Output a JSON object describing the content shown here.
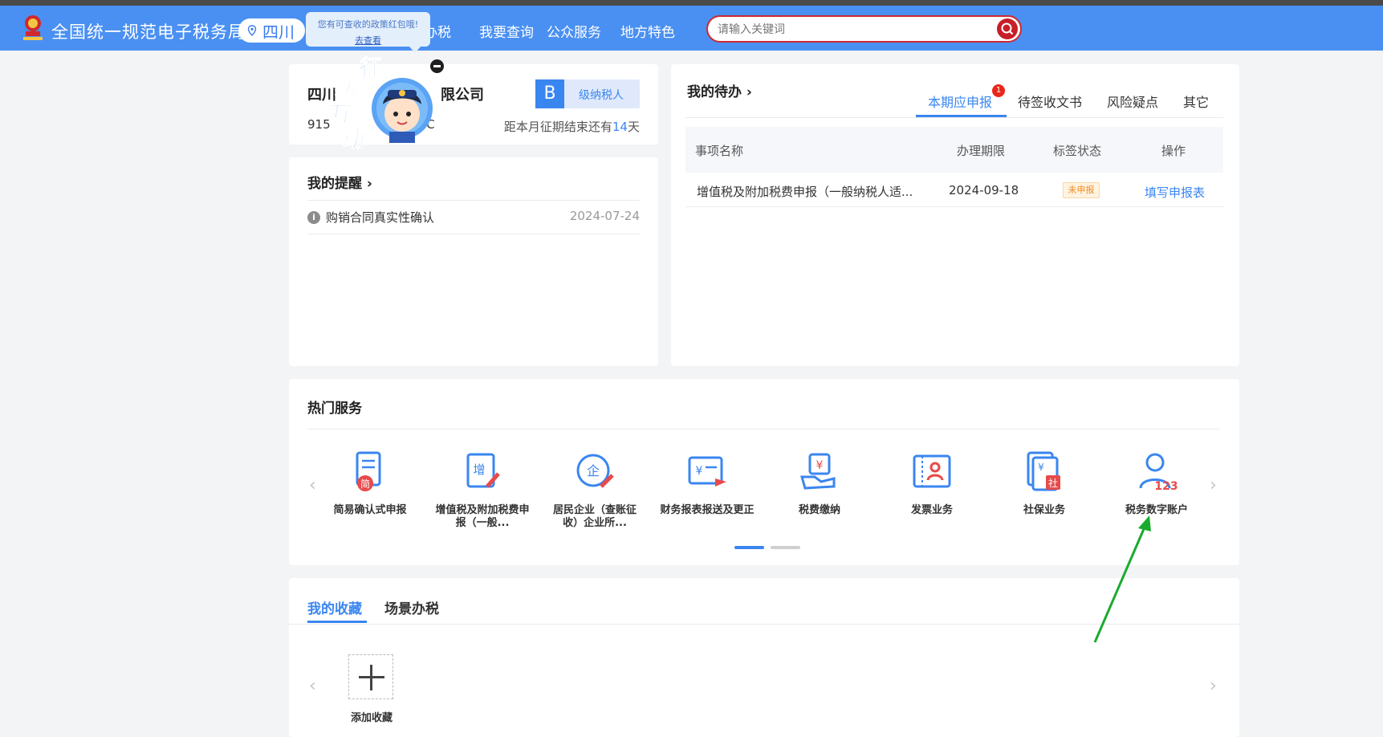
{
  "header": {
    "title": "全国统一规范电子税务局",
    "region": "四川",
    "nav": [
      "办税",
      "我要查询",
      "公众服务",
      "地方特色"
    ],
    "search_placeholder": "请输入关键词",
    "brand_color": "#4a90f2"
  },
  "tooltip": {
    "text": "您有可查收的政策红包哦!",
    "link": "去查看"
  },
  "mascot": {
    "chars": [
      "征",
      "纳",
      "互",
      "动"
    ]
  },
  "company": {
    "name_visible": "四川",
    "name_suffix": "限公司",
    "id_prefix": "915",
    "id_suffix": "2C",
    "level_letter": "B",
    "level_text": "级纳税人",
    "period_prefix": "距本月征期结束还有",
    "period_days": "14",
    "period_suffix": "天"
  },
  "reminders": {
    "title": "我的提醒",
    "items": [
      {
        "text": "购销合同真实性确认",
        "date": "2024-07-24"
      }
    ]
  },
  "todo": {
    "title": "我的待办",
    "tabs": [
      {
        "label": "本期应申报",
        "badge": "1",
        "active": true
      },
      {
        "label": "待签收文书"
      },
      {
        "label": "风险疑点"
      },
      {
        "label": "其它"
      }
    ],
    "columns": [
      "事项名称",
      "办理期限",
      "标签状态",
      "操作"
    ],
    "rows": [
      {
        "name": "增值税及附加税费申报（一般纳税人适...",
        "deadline": "2024-09-18",
        "status": "未申报",
        "action": "填写申报表"
      }
    ]
  },
  "hot_services": {
    "title": "热门服务",
    "items": [
      {
        "label": "简易确认式申报",
        "icon": "simple-declare-icon"
      },
      {
        "label": "增值税及附加税费申报（一般...",
        "icon": "vat-declare-icon"
      },
      {
        "label": "居民企业（查账征收）企业所...",
        "icon": "enterprise-tax-icon"
      },
      {
        "label": "财务报表报送及更正",
        "icon": "financial-report-icon"
      },
      {
        "label": "税费缴纳",
        "icon": "tax-payment-icon"
      },
      {
        "label": "发票业务",
        "icon": "invoice-icon"
      },
      {
        "label": "社保业务",
        "icon": "social-security-icon"
      },
      {
        "label": "税务数字账户",
        "icon": "digital-account-icon"
      }
    ]
  },
  "favorites": {
    "tabs": [
      {
        "label": "我的收藏",
        "active": true
      },
      {
        "label": "场景办税"
      }
    ],
    "add_label": "添加收藏"
  }
}
